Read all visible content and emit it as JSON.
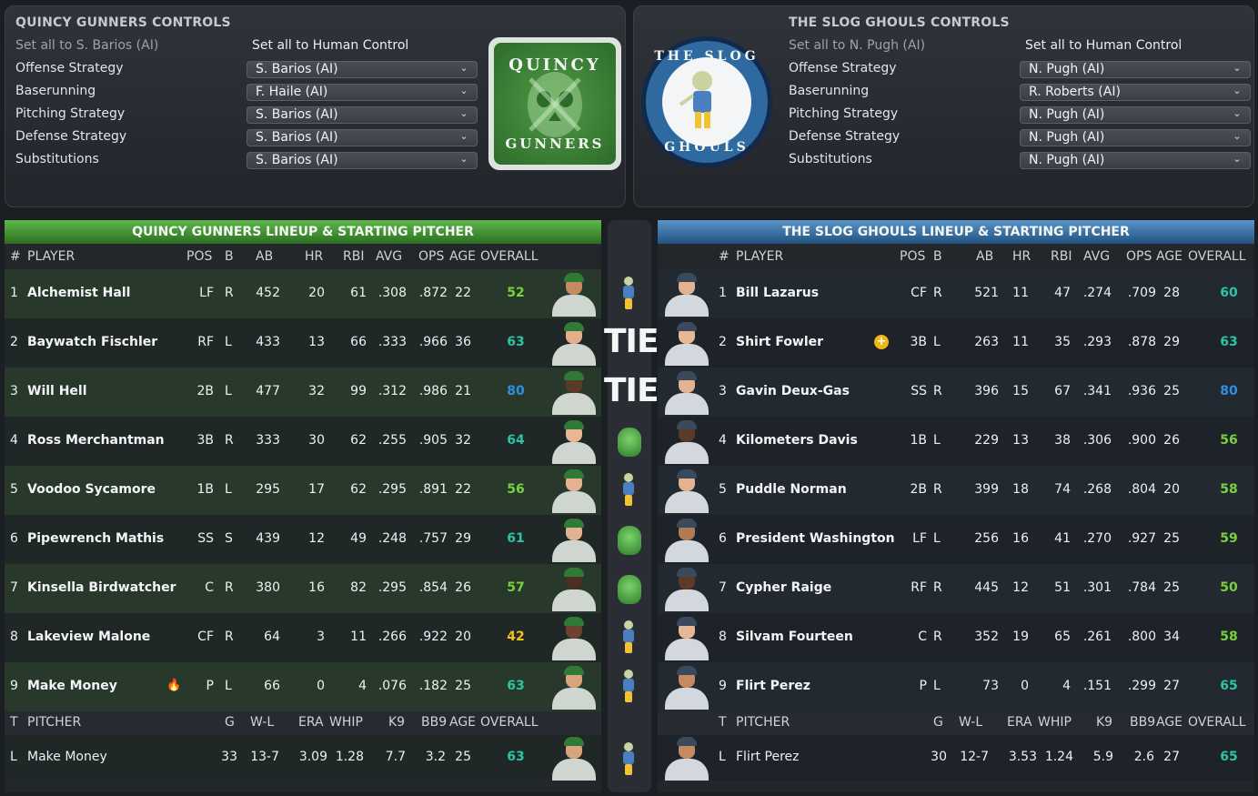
{
  "left_controls": {
    "title": "QUINCY GUNNERS CONTROLS",
    "set_all_ai": "Set all to S. Barios (AI)",
    "set_all_human": "Set all to Human Control",
    "rows": [
      {
        "label": "Offense Strategy",
        "value": "S. Barios (AI)"
      },
      {
        "label": "Baserunning",
        "value": "F. Haile (AI)"
      },
      {
        "label": "Pitching Strategy",
        "value": "S. Barios (AI)"
      },
      {
        "label": "Defense Strategy",
        "value": "S. Barios (AI)"
      },
      {
        "label": "Substitutions",
        "value": "S. Barios (AI)"
      }
    ],
    "logo_text_top": "QUINCY",
    "logo_text_bottom": "GUNNERS"
  },
  "right_controls": {
    "title": "THE SLOG GHOULS CONTROLS",
    "set_all_ai": "Set all to N. Pugh (AI)",
    "set_all_human": "Set all to Human Control",
    "rows": [
      {
        "label": "Offense Strategy",
        "value": "N. Pugh (AI)"
      },
      {
        "label": "Baserunning",
        "value": "R. Roberts (AI)"
      },
      {
        "label": "Pitching Strategy",
        "value": "N. Pugh (AI)"
      },
      {
        "label": "Defense Strategy",
        "value": "N. Pugh (AI)"
      },
      {
        "label": "Substitutions",
        "value": "N. Pugh (AI)"
      }
    ],
    "logo_text_top": "THE SLOG",
    "logo_text_bottom": "GHOULS"
  },
  "chevron_glyph": "⌄",
  "batting_columns": {
    "num": "#",
    "player": "PLAYER",
    "pos": "POS",
    "b": "B",
    "ab": "AB",
    "hr": "HR",
    "rbi": "RBI",
    "avg": "AVG",
    "ops": "OPS",
    "age": "AGE",
    "overall": "OVERALL"
  },
  "pitching_columns": {
    "t": "T",
    "pitcher": "PITCHER",
    "g": "G",
    "wl": "W-L",
    "era": "ERA",
    "whip": "WHIP",
    "k9": "K9",
    "bb9": "BB9",
    "age": "AGE",
    "overall": "OVERALL"
  },
  "left_lineup": {
    "header": "QUINCY GUNNERS LINEUP & STARTING PITCHER",
    "batters": [
      {
        "num": "1",
        "name": "Alchemist Hall",
        "pos": "LF",
        "b": "R",
        "ab": "452",
        "hr": "20",
        "rbi": "61",
        "avg": ".308",
        "ops": ".872",
        "age": "22",
        "overall": "52",
        "ovr_color": "#79d23a",
        "skin": "#c48a62"
      },
      {
        "num": "2",
        "name": "Baywatch Fischler",
        "pos": "RF",
        "b": "L",
        "ab": "433",
        "hr": "13",
        "rbi": "66",
        "avg": ".333",
        "ops": ".966",
        "age": "36",
        "overall": "63",
        "ovr_color": "#2cc4a4",
        "skin": "#e1b08a"
      },
      {
        "num": "3",
        "name": "Will Hell",
        "pos": "2B",
        "b": "L",
        "ab": "477",
        "hr": "32",
        "rbi": "99",
        "avg": ".312",
        "ops": ".986",
        "age": "21",
        "overall": "80",
        "ovr_color": "#2e8fe8",
        "skin": "#5a3a28"
      },
      {
        "num": "4",
        "name": "Ross Merchantman",
        "pos": "3B",
        "b": "R",
        "ab": "333",
        "hr": "30",
        "rbi": "62",
        "avg": ".255",
        "ops": ".905",
        "age": "32",
        "overall": "64",
        "ovr_color": "#2cc4a4",
        "skin": "#e6b896"
      },
      {
        "num": "5",
        "name": "Voodoo Sycamore",
        "pos": "1B",
        "b": "L",
        "ab": "295",
        "hr": "17",
        "rbi": "62",
        "avg": ".295",
        "ops": ".891",
        "age": "22",
        "overall": "56",
        "ovr_color": "#79d23a",
        "skin": "#e3b391"
      },
      {
        "num": "6",
        "name": "Pipewrench Mathis",
        "pos": "SS",
        "b": "S",
        "ab": "439",
        "hr": "12",
        "rbi": "49",
        "avg": ".248",
        "ops": ".757",
        "age": "29",
        "overall": "61",
        "ovr_color": "#2cc4a4",
        "skin": "#e3b391"
      },
      {
        "num": "7",
        "name": "Kinsella Birdwatcher",
        "pos": "C",
        "b": "R",
        "ab": "380",
        "hr": "16",
        "rbi": "82",
        "avg": ".295",
        "ops": ".854",
        "age": "26",
        "overall": "57",
        "ovr_color": "#79d23a",
        "skin": "#4a2f22"
      },
      {
        "num": "8",
        "name": "Lakeview Malone",
        "pos": "CF",
        "b": "R",
        "ab": "64",
        "hr": "3",
        "rbi": "11",
        "avg": ".266",
        "ops": ".922",
        "age": "20",
        "overall": "42",
        "ovr_color": "#f0c418",
        "skin": "#6b4330"
      },
      {
        "num": "9",
        "name": "Make Money",
        "pos": "P",
        "b": "L",
        "ab": "66",
        "hr": "0",
        "rbi": "4",
        "avg": ".076",
        "ops": ".182",
        "age": "25",
        "overall": "63",
        "ovr_color": "#2cc4a4",
        "skin": "#d9a47c"
      }
    ],
    "pitcher": {
      "t": "L",
      "name": "Make Money",
      "g": "33",
      "wl": "13-7",
      "era": "3.09",
      "whip": "1.28",
      "k9": "7.7",
      "bb9": "3.2",
      "age": "25",
      "overall": "63",
      "ovr_color": "#2cc4a4",
      "skin": "#d9a47c"
    }
  },
  "right_lineup": {
    "header": "THE SLOG GHOULS LINEUP & STARTING PITCHER",
    "batters": [
      {
        "num": "1",
        "name": "Bill Lazarus",
        "pos": "CF",
        "b": "R",
        "ab": "521",
        "hr": "11",
        "rbi": "47",
        "avg": ".274",
        "ops": ".709",
        "age": "28",
        "overall": "60",
        "ovr_color": "#2cc4a4",
        "skin": "#e3b391"
      },
      {
        "num": "2",
        "name": "Shirt Fowler",
        "pos": "3B",
        "b": "L",
        "ab": "263",
        "hr": "11",
        "rbi": "35",
        "avg": ".293",
        "ops": ".878",
        "age": "29",
        "overall": "63",
        "ovr_color": "#2cc4a4",
        "skin": "#e6b896"
      },
      {
        "num": "3",
        "name": "Gavin Deux-Gas",
        "pos": "SS",
        "b": "R",
        "ab": "396",
        "hr": "15",
        "rbi": "67",
        "avg": ".341",
        "ops": ".936",
        "age": "25",
        "overall": "80",
        "ovr_color": "#2e8fe8",
        "skin": "#e3b391"
      },
      {
        "num": "4",
        "name": "Kilometers Davis",
        "pos": "1B",
        "b": "L",
        "ab": "229",
        "hr": "13",
        "rbi": "38",
        "avg": ".306",
        "ops": ".900",
        "age": "26",
        "overall": "56",
        "ovr_color": "#79d23a",
        "skin": "#5a3a28"
      },
      {
        "num": "5",
        "name": "Puddle Norman",
        "pos": "2B",
        "b": "R",
        "ab": "399",
        "hr": "18",
        "rbi": "74",
        "avg": ".268",
        "ops": ".804",
        "age": "20",
        "overall": "58",
        "ovr_color": "#79d23a",
        "skin": "#e3b391"
      },
      {
        "num": "6",
        "name": "President Washington",
        "pos": "LF",
        "b": "L",
        "ab": "256",
        "hr": "16",
        "rbi": "41",
        "avg": ".270",
        "ops": ".927",
        "age": "25",
        "overall": "59",
        "ovr_color": "#79d23a",
        "skin": "#b07a55"
      },
      {
        "num": "7",
        "name": "Cypher Raige",
        "pos": "RF",
        "b": "R",
        "ab": "445",
        "hr": "12",
        "rbi": "51",
        "avg": ".301",
        "ops": ".784",
        "age": "25",
        "overall": "50",
        "ovr_color": "#79d23a",
        "skin": "#5a3a28"
      },
      {
        "num": "8",
        "name": "Silvam Fourteen",
        "pos": "C",
        "b": "R",
        "ab": "352",
        "hr": "19",
        "rbi": "65",
        "avg": ".261",
        "ops": ".800",
        "age": "34",
        "overall": "58",
        "ovr_color": "#79d23a",
        "skin": "#e6b896"
      },
      {
        "num": "9",
        "name": "Flirt Perez",
        "pos": "P",
        "b": "L",
        "ab": "73",
        "hr": "0",
        "rbi": "4",
        "avg": ".151",
        "ops": ".299",
        "age": "27",
        "overall": "65",
        "ovr_color": "#2cc4a4",
        "skin": "#c48a62"
      }
    ],
    "pitcher": {
      "t": "L",
      "name": "Flirt Perez",
      "g": "30",
      "wl": "12-7",
      "era": "3.53",
      "whip": "1.24",
      "k9": "5.9",
      "bb9": "2.6",
      "age": "27",
      "overall": "65",
      "ovr_color": "#2cc4a4",
      "skin": "#c48a62"
    }
  },
  "matchups": [
    "ghoul",
    "tie",
    "tie",
    "gunner",
    "ghoul",
    "gunner",
    "gunner",
    "ghoul",
    "ghoul",
    "ghoul"
  ],
  "tie_label": "TIE",
  "icons": {
    "hot_streak": "fire-icon",
    "boost": "plus-star-icon"
  },
  "colors": {
    "gunners_green": "#3f9a34",
    "ghouls_blue": "#2e6aa0"
  }
}
